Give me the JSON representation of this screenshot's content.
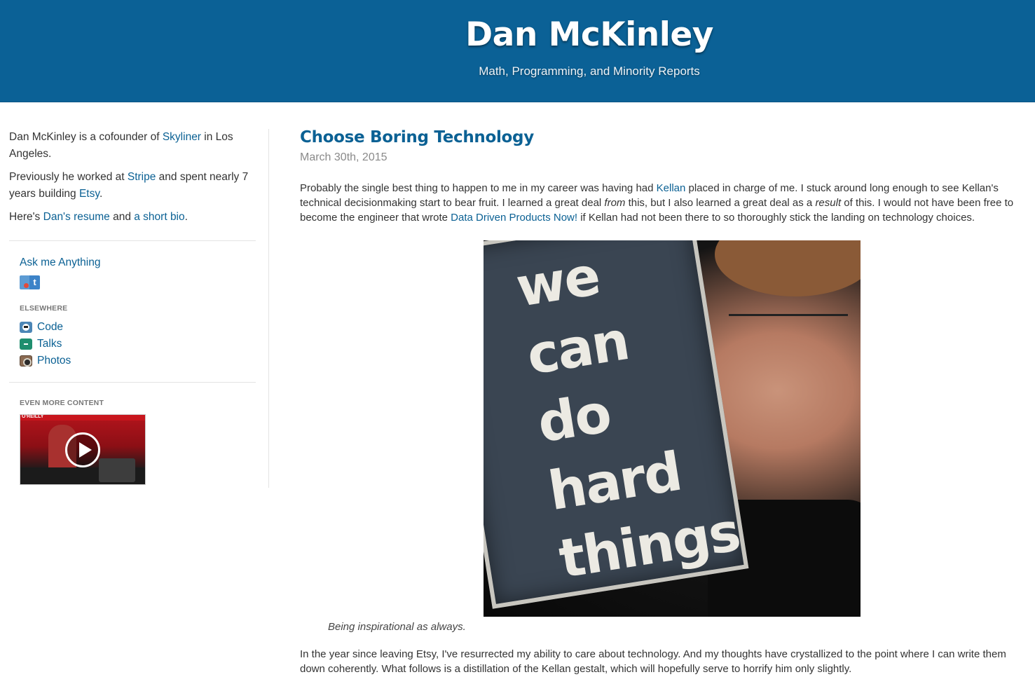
{
  "header": {
    "title": "Dan McKinley",
    "subtitle": "Math, Programming, and Minority Reports"
  },
  "sidebar": {
    "bio": {
      "p1_prefix": "Dan McKinley is a cofounder of ",
      "p1_link": "Skyliner",
      "p1_suffix": " in Los Angeles.",
      "p2_prefix": "Previously he worked at ",
      "p2_link1": "Stripe",
      "p2_mid": " and spent nearly 7 years building ",
      "p2_link2": "Etsy",
      "p2_suffix": ".",
      "p3_prefix": "Here's ",
      "p3_link1": "Dan's resume",
      "p3_mid": " and ",
      "p3_link2": "a short bio",
      "p3_suffix": "."
    },
    "ama_label": "Ask me Anything",
    "ama_icon": "twitter-ama-icon",
    "elsewhere_heading": "ELSEWHERE",
    "elsewhere": [
      {
        "label": "Code",
        "icon": "github-icon"
      },
      {
        "label": "Talks",
        "icon": "speakerdeck-icon"
      },
      {
        "label": "Photos",
        "icon": "instagram-icon"
      }
    ],
    "more_heading": "EVEN MORE CONTENT",
    "video": {
      "brand": "O'REILLY",
      "icon": "play-icon"
    }
  },
  "post": {
    "title": "Choose Boring Technology",
    "date": "March 30th, 2015",
    "p1": {
      "a": "Probably the single best thing to happen to me in my career was having had ",
      "link1": "Kellan",
      "b": " placed in charge of me. I stuck around long enough to see Kellan's technical decisionmaking start to bear fruit. I learned a great deal ",
      "em1": "from",
      "c": " this, but I also learned a great deal as a ",
      "em2": "result",
      "d": " of this. I would not have been free to become the engineer that wrote ",
      "link2": "Data Driven Products Now!",
      "e": " if Kellan had not been there to so thoroughly stick the landing on technology choices."
    },
    "photo": {
      "sign_lines": [
        "we",
        "can",
        "do",
        "hard",
        "things"
      ],
      "caption": "Being inspirational as always."
    },
    "p2": "In the year since leaving Etsy, I've resurrected my ability to care about technology. And my thoughts have crystallized to the point where I can write them down coherently. What follows is a distillation of the Kellan gestalt, which will hopefully serve to horrify him only slightly."
  },
  "colors": {
    "header_bg": "#0b6196",
    "link": "#0b6194",
    "text": "#333333",
    "muted": "#8a8a8a"
  }
}
